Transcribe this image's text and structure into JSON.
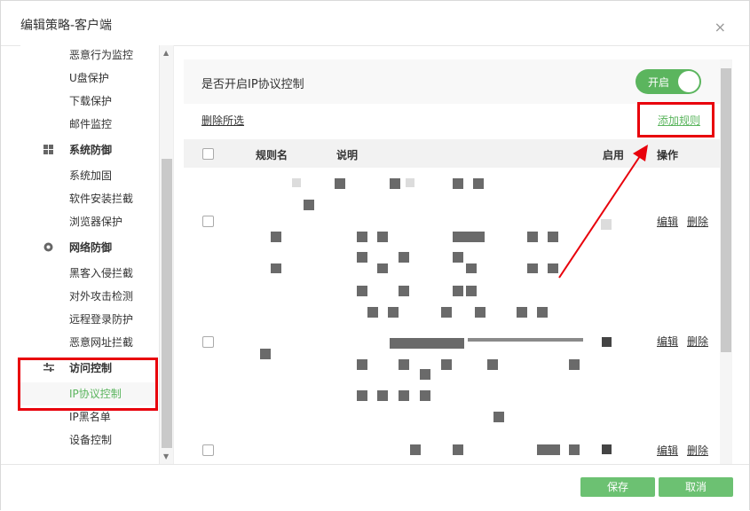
{
  "window": {
    "title": "编辑策略-客户端",
    "close_glyph": "×"
  },
  "sidebar": {
    "items": [
      {
        "label": "恶意行为监控",
        "type": "item"
      },
      {
        "label": "U盘保护",
        "type": "item"
      },
      {
        "label": "下载保护",
        "type": "item"
      },
      {
        "label": "邮件监控",
        "type": "item"
      },
      {
        "label": "系统防御",
        "type": "category",
        "icon": "windows-icon"
      },
      {
        "label": "系统加固",
        "type": "item"
      },
      {
        "label": "软件安装拦截",
        "type": "item"
      },
      {
        "label": "浏览器保护",
        "type": "item"
      },
      {
        "label": "网络防御",
        "type": "category",
        "icon": "globe-icon"
      },
      {
        "label": "黑客入侵拦截",
        "type": "item"
      },
      {
        "label": "对外攻击检测",
        "type": "item"
      },
      {
        "label": "远程登录防护",
        "type": "item"
      },
      {
        "label": "恶意网址拦截",
        "type": "item"
      },
      {
        "label": "访问控制",
        "type": "category",
        "icon": "sliders-icon"
      },
      {
        "label": "IP协议控制",
        "type": "item",
        "active": true
      },
      {
        "label": "IP黑名单",
        "type": "item"
      },
      {
        "label": "设备控制",
        "type": "item"
      }
    ]
  },
  "main": {
    "toggle_label": "是否开启IP协议控制",
    "toggle_state": "开启",
    "delete_selected": "删除所选",
    "add_rule": "添加规则",
    "table": {
      "headers": {
        "name": "规则名",
        "desc": "说明",
        "enabled": "启用",
        "ops": "操作"
      },
      "rows": [
        {
          "edit": "编辑",
          "delete": "删除"
        },
        {
          "edit": "编辑",
          "delete": "删除"
        },
        {
          "edit": "编辑",
          "delete": "删除"
        }
      ]
    }
  },
  "footer": {
    "save": "保存",
    "cancel": "取消"
  },
  "colors": {
    "accent": "#5bb55e",
    "highlight": "#e8000b"
  }
}
